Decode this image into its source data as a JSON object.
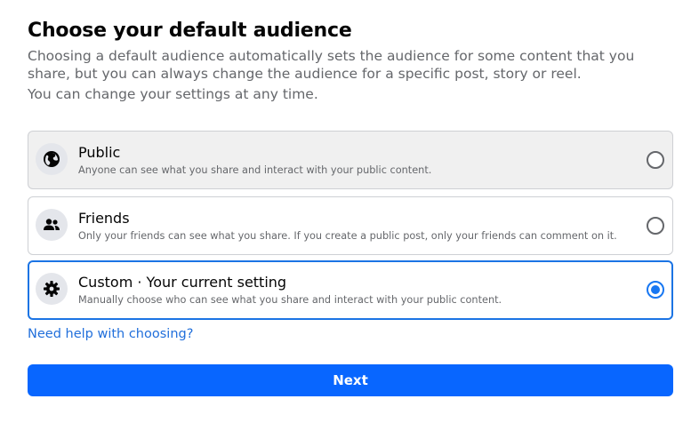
{
  "header": {
    "title": "Choose your default audience",
    "description": "Choosing a default audience automatically sets the audience for some content that you share, but you can always change the audience for a specific post, story or reel.",
    "description2": "You can change your settings at any time."
  },
  "options": [
    {
      "id": "public",
      "label": "Public",
      "sublabel": "Anyone can see what you share and interact with your public content.",
      "icon": "globe-icon",
      "selected": false
    },
    {
      "id": "friends",
      "label": "Friends",
      "sublabel": "Only your friends can see what you share. If you create a public post, only your friends can comment on it.",
      "icon": "friends-icon",
      "selected": false
    },
    {
      "id": "custom",
      "label": "Custom · Your current setting",
      "sublabel": "Manually choose who can see what you share and interact with your public content.",
      "icon": "gear-icon",
      "selected": true
    }
  ],
  "help_link": "Need help with choosing?",
  "next_button": "Next",
  "colors": {
    "accent": "#1877f2",
    "button": "#0866ff",
    "link": "#216fdb",
    "muted_text": "#65676b"
  }
}
